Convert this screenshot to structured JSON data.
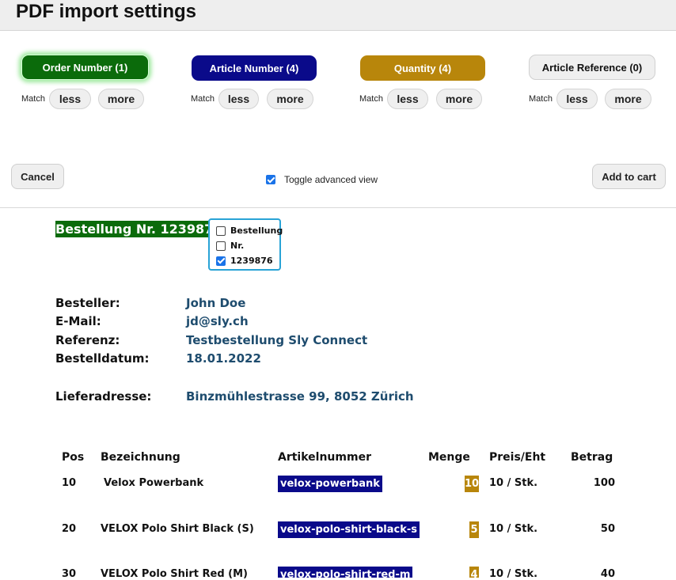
{
  "app": {
    "title": "PDF import settings"
  },
  "chips": [
    {
      "label": "Order Number (1)"
    },
    {
      "label": "Article Number (4)"
    },
    {
      "label": "Quantity (4)"
    },
    {
      "label": "Article Reference (0)"
    }
  ],
  "match": {
    "label": "Match",
    "less": "less",
    "more": "more"
  },
  "controls": {
    "cancel": "Cancel",
    "toggle_label": "Toggle advanced view",
    "add_to_cart": "Add to cart",
    "toggle_checked": true
  },
  "doc": {
    "order_title": "Bestellung Nr. 1239876",
    "popup": [
      {
        "label": "Bestellung",
        "checked": false
      },
      {
        "label": "Nr.",
        "checked": false
      },
      {
        "label": "1239876",
        "checked": true
      }
    ],
    "fields": [
      {
        "label": "Besteller:",
        "value": "John Doe"
      },
      {
        "label": "E-Mail:",
        "value": "jd@sly.ch"
      },
      {
        "label": "Referenz:",
        "value": "Testbestellung Sly Connect"
      },
      {
        "label": "Bestelldatum:",
        "value": "18.01.2022"
      }
    ],
    "delivery": {
      "label": "Lieferadresse:",
      "value": "Binzmühlestrasse 99, 8052 Zürich"
    },
    "table": {
      "headers": [
        "Pos",
        "Bezeichnung",
        "Artikelnummer",
        "Menge",
        "Preis/Eht",
        "Betrag"
      ],
      "rows": [
        {
          "pos": "10",
          "name": "Velox Powerbank",
          "article": "velox-powerbank",
          "qty": "10",
          "price": "10 / Stk.",
          "total": "100"
        },
        {
          "pos": "20",
          "name": "VELOX Polo Shirt Black (S)",
          "article": "velox-polo-shirt-black-s",
          "qty": "5",
          "price": "10 / Stk.",
          "total": "50"
        },
        {
          "pos": "30",
          "name": "VELOX Polo Shirt Red (M)",
          "article": "velox-polo-shirt-red-m",
          "qty": "4",
          "price": "10 / Stk.",
          "total": "40"
        }
      ]
    }
  }
}
